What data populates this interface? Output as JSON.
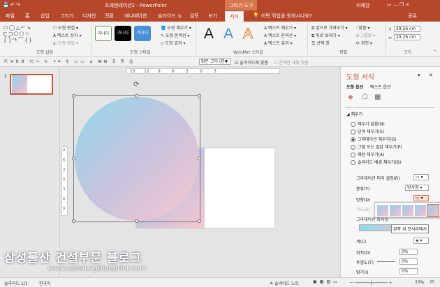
{
  "titlebar": {
    "doc_title": "프레젠테이션2  -  PowerPoint",
    "context_tab": "그리기 도구",
    "user": "이혜강"
  },
  "tabs": [
    "파일",
    "홈",
    "삽입",
    "그리기",
    "디자인",
    "전환",
    "애니메이션",
    "슬라이드 쇼",
    "검토",
    "보기",
    "서식"
  ],
  "tell_me": "어떤 작업을 원하시나요?",
  "share": "공유",
  "ribbon": {
    "groups": [
      "도형 삽입",
      "도형 스타일",
      "WordArt 스타일",
      "정렬",
      "크기"
    ],
    "edit_shape": "도형 편집",
    "text_box": "텍스트 상자",
    "merge_shapes": "도형 병합",
    "style_swatches": [
      "가나다",
      "가나다",
      "가나다"
    ],
    "shape_fill": "도형 채우기",
    "shape_outline": "도형 윤곽선",
    "shape_effects": "도형 효과",
    "wordart_letter": "A",
    "text_fill": "텍스트 채우기",
    "text_outline": "텍스트 윤곽선",
    "text_effects": "텍스트 효과",
    "bring_forward": "앞으로 가져오기",
    "send_backward": "뒤로 보내기",
    "selection_pane": "선택 창",
    "align": "맞춤",
    "group": "그룹화",
    "rotate": "회전",
    "height": "29.26 cm",
    "width": "29.26 cm"
  },
  "qat": {
    "font": "맑은 고딕 (본▼",
    "fit_slide": "슬라이드에 맞춤",
    "select_obj": "선택한 개체 맞춤"
  },
  "thumb_number": "1",
  "ruler": {
    "top": [
      "15",
      "12",
      "9",
      "6",
      "3",
      "0",
      "3"
    ],
    "left": [
      "9",
      "6",
      "3",
      "0",
      "3",
      "6",
      "9"
    ]
  },
  "pane": {
    "title": "도형 서식",
    "tabs": [
      "도형 옵션",
      "텍스트 옵션"
    ],
    "section": "채우기",
    "fill_options": [
      "채우기 없음(N)",
      "단색 채우기(S)",
      "그라데이션 채우기(G)",
      "그림 또는 질감 채우기(P)",
      "패턴 채우기(A)",
      "슬라이드 배경 채우기(B)"
    ],
    "preset_label": "그라데이션 미리 설정(R)",
    "type_label": "종류(Y)",
    "type_value": "방사형",
    "direction_label": "방향(D)",
    "angle_label": "각도(E)",
    "stops_label": "그라데이션 중지점",
    "tooltip": "왼쪽 위 모서리에서",
    "color_label": "색(C)",
    "position_label": "위치(O)",
    "position_value": "0%",
    "transparency_label": "투명도(T)",
    "transparency_value": "0%",
    "brightness_label": "밝기(I)",
    "brightness_value": "0%"
  },
  "status": {
    "slide": "슬라이드 1/1",
    "lang": "한국어",
    "notes": "슬라이드 노트",
    "zoom": "33%"
  },
  "watermark": {
    "title": "삼성물산 건설부문 블로그",
    "url": "www.samsungblueprint.com"
  }
}
